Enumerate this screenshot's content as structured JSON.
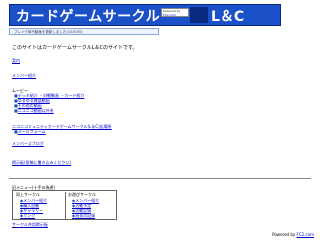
{
  "banner": {
    "title": "カードゲームサークル",
    "title_tail": "L＆C",
    "ad_line1": "Powered by",
    "ad_link": "FC2.com"
  },
  "notice_strip": "ブレイク時不動画を更新しました(10/5/05)",
  "intro": "このサイトはカードゲームサークルL＆Cのサイトです。",
  "links": {
    "events": "案内",
    "members": "メンバー紹介",
    "movies_heading": "ムービー",
    "movies": [
      "デッキ紹介 ・対戦動画 ・カード紹介",
      "ゆるゆる雑談動画",
      "その他の動画",
      "ニコニコ動画以外系"
    ],
    "nico_line": "ニコニコミュニティカードゲームサークル(L＆C)広場所",
    "mail_form": "メールフォーム",
    "member_blog": "メンバーズブログ",
    "bbs": "掲示板(投稿に書き込みください)"
  },
  "bottom": {
    "title": "旧メニュー(十手の為遊)",
    "left_col": {
      "title": "同上サークル",
      "items": [
        "メンバー紹介",
        "購入自動",
        "ギャラリー",
        "リンク"
      ]
    },
    "right_col": {
      "title": "お遊びサークル",
      "items": [
        "メンバー紹介",
        "活動予定",
        "活動記録",
        "過去の記録"
      ]
    },
    "below_link": "サークル共用掲示板"
  },
  "footer": {
    "powered_prefix": "Powered by",
    "powered_link": "FC2.com"
  },
  "colors": {
    "banner": "#1a50c8",
    "link": "#0000cc"
  }
}
